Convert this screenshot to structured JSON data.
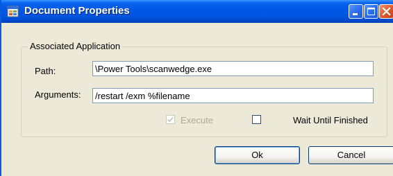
{
  "window": {
    "title": "Document Properties",
    "controls": {
      "minimize_icon": "minimize-icon",
      "maximize_icon": "maximize-icon",
      "close_icon": "close-icon"
    }
  },
  "group": {
    "legend": "Associated Application"
  },
  "fields": {
    "path": {
      "label": "Path:",
      "value": "\\Power Tools\\scanwedge.exe"
    },
    "arguments": {
      "label": "Arguments:",
      "value": "/restart /exm %filename"
    }
  },
  "options": {
    "execute": {
      "label": "Execute",
      "checked": true,
      "enabled": false
    },
    "wait_until_finished": {
      "label": "Wait Until Finished",
      "checked": false,
      "enabled": true
    }
  },
  "buttons": {
    "ok": "Ok",
    "cancel": "Cancel"
  },
  "colors": {
    "titlebar": "#0058e6",
    "dialog_bg": "#ece9d8",
    "disabled_text": "#aca899"
  }
}
